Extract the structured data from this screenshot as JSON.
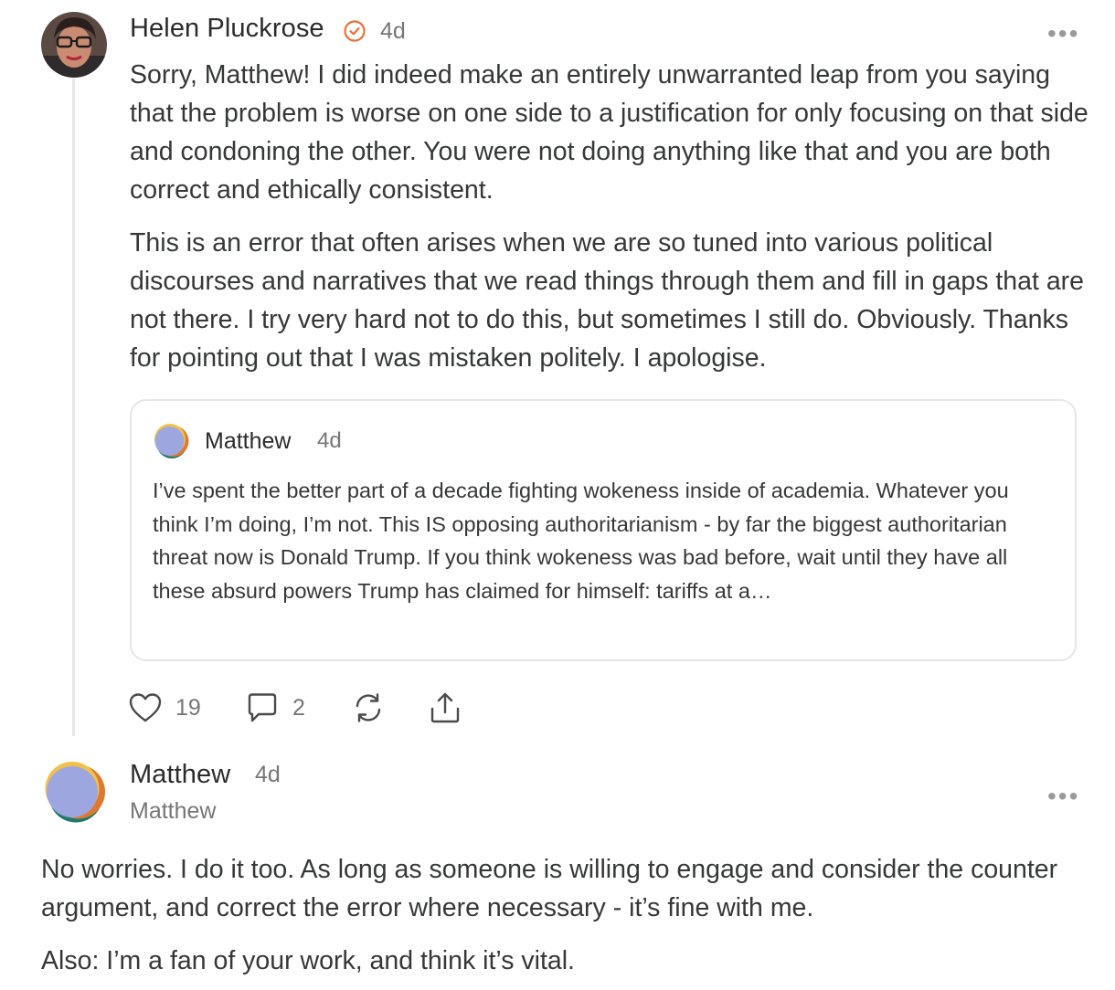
{
  "colors": {
    "accent": "#e8703a",
    "avatar_lavender": "#9ea6e0",
    "avatar_orange": "#e0792e",
    "avatar_yellow": "#f0c24a",
    "avatar_teal": "#1f7a6e"
  },
  "comment1": {
    "author": "Helen Pluckrose",
    "badge_icon": "verified-check-icon",
    "time": "4d",
    "more_label": "•••",
    "paragraphs": [
      "Sorry, Matthew! I did indeed make an entirely unwarranted leap from you saying that the problem is worse on one side to a justification for only focusing on that side and condoning the other. You were not doing anything like that and you are both correct and ethically consistent.",
      "This is an error that often arises when we are so tuned into various political discourses and narratives that we read things through them and fill in gaps that are not there. I try very hard not to do this, but sometimes I still do. Obviously. Thanks for pointing out that I was mistaken politely. I apologise."
    ],
    "quote": {
      "author": "Matthew",
      "time": "4d",
      "text": "I’ve spent the better part of a decade fighting wokeness inside of academia. Whatever you think I’m doing, I’m not. This IS opposing authoritarianism - by far the biggest authoritarian threat now is Donald Trump. If you think wokeness was bad before, wait until they have all these absurd powers Trump has claimed for himself: tariffs at a…"
    },
    "actions": {
      "likes": "19",
      "replies": "2"
    }
  },
  "comment2": {
    "author": "Matthew",
    "time": "4d",
    "handle": "Matthew",
    "more_label": "•••",
    "paragraphs": [
      "No worries. I do it too. As long as someone is willing to engage and consider the counter argument, and correct the error where necessary - it’s fine with me.",
      "Also: I’m a fan of your work, and think it’s vital."
    ]
  }
}
